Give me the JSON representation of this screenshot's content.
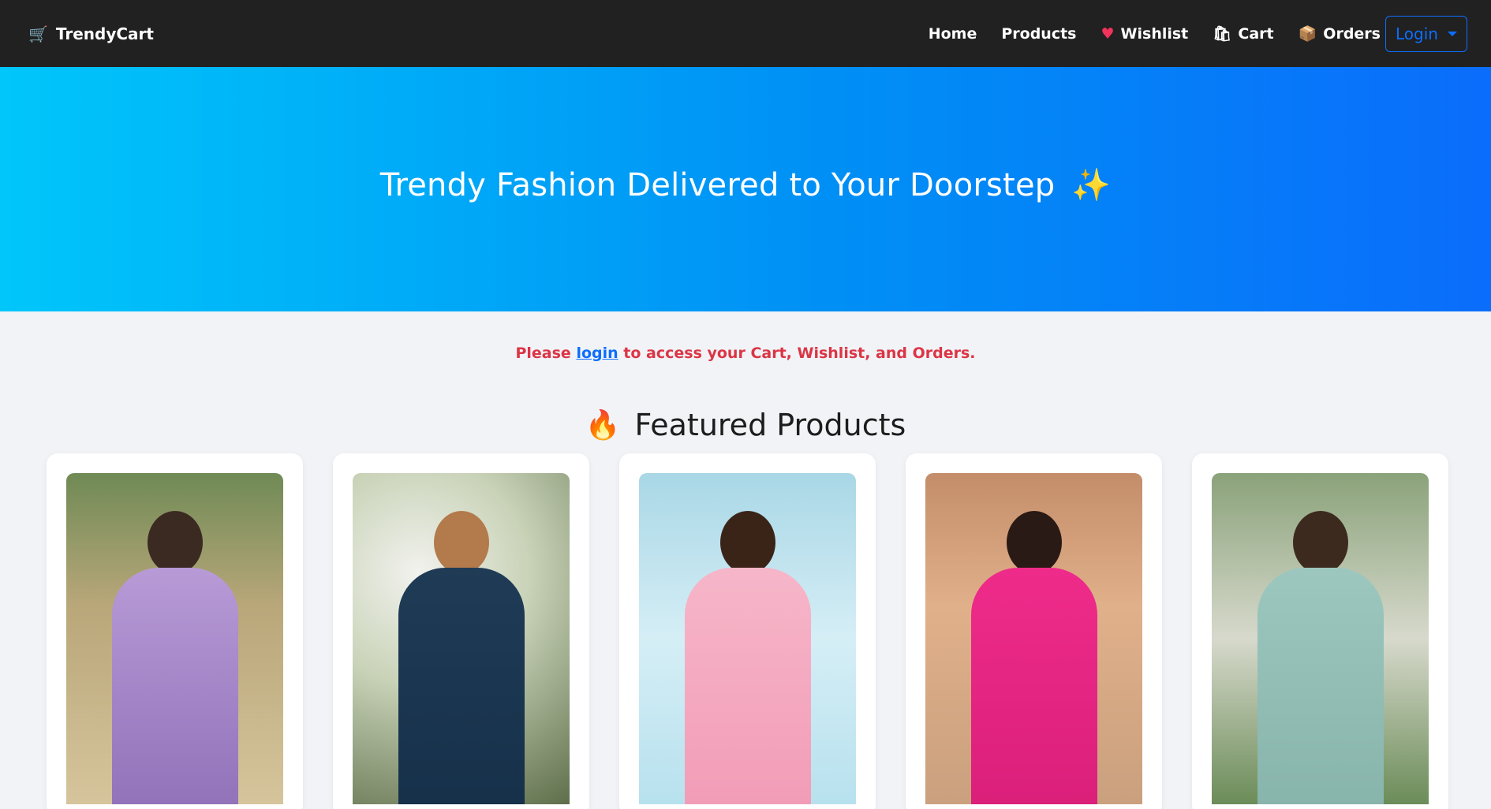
{
  "navbar": {
    "brand": "TrendyCart",
    "brand_icon": "shopping-cart-icon",
    "links": {
      "home": "Home",
      "products": "Products",
      "wishlist": "Wishlist",
      "cart": "Cart",
      "orders": "Orders"
    },
    "login_button": "Login"
  },
  "hero": {
    "title": "Trendy Fashion Delivered to Your Doorstep",
    "sparkle": "✨"
  },
  "login_note": {
    "prefix": "Please",
    "link": "login",
    "suffix": "to access your Cart, Wishlist, and Orders."
  },
  "featured": {
    "title": "Featured Products",
    "icon": "fire-icon"
  },
  "colors": {
    "navbar_bg": "#212121",
    "accent": "#0d6efd",
    "warning_text": "#dc3545",
    "hero_gradient_start": "#00c6fa",
    "hero_gradient_end": "#0a6dfb"
  }
}
